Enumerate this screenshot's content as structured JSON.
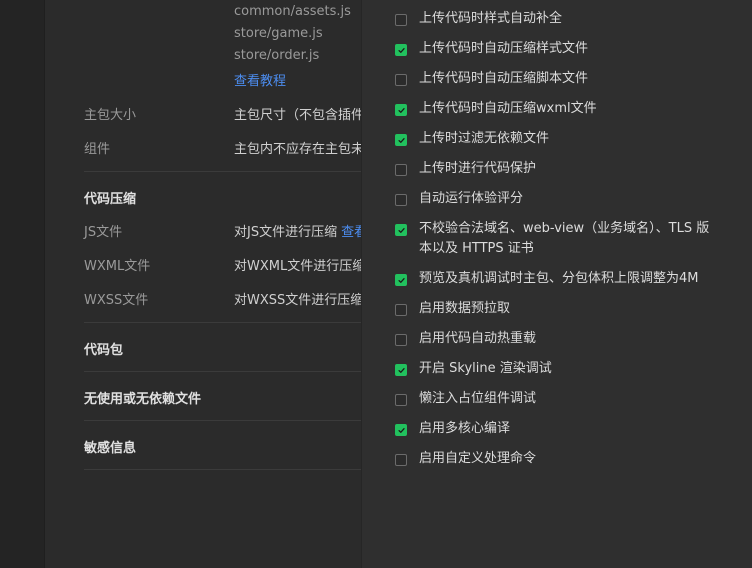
{
  "left": {
    "file_list": [
      "common/assets.js",
      "store/game.js",
      "store/order.js"
    ],
    "doc_link": "查看教程",
    "rows_top": [
      {
        "label": "主包大小",
        "value": "主包尺寸（不包含插件"
      },
      {
        "label": "组件",
        "value": "主包内不应存在主包未"
      }
    ],
    "compress": {
      "title": "代码压缩",
      "rows": [
        {
          "label": "JS文件",
          "value": "对JS文件进行压缩",
          "link": "查看"
        },
        {
          "label": "WXML文件",
          "value": "对WXML文件进行压缩"
        },
        {
          "label": "WXSS文件",
          "value": "对WXSS文件进行压缩"
        }
      ]
    },
    "sections": [
      "代码包",
      "无使用或无依赖文件",
      "敏感信息"
    ]
  },
  "options": [
    {
      "label": "上传代码时样式自动补全",
      "checked": false
    },
    {
      "label": "上传代码时自动压缩样式文件",
      "checked": true
    },
    {
      "label": "上传代码时自动压缩脚本文件",
      "checked": false
    },
    {
      "label": "上传代码时自动压缩wxml文件",
      "checked": true
    },
    {
      "label": "上传时过滤无依赖文件",
      "checked": true
    },
    {
      "label": "上传时进行代码保护",
      "checked": false
    },
    {
      "label": "自动运行体验评分",
      "checked": false
    },
    {
      "label": "不校验合法域名、web-view（业务域名）、TLS 版本以及 HTTPS 证书",
      "checked": true
    },
    {
      "label": "预览及真机调试时主包、分包体积上限调整为4M",
      "checked": true
    },
    {
      "label": "启用数据预拉取",
      "checked": false
    },
    {
      "label": "启用代码自动热重载",
      "checked": false
    },
    {
      "label": "开启 Skyline 渲染调试",
      "checked": true
    },
    {
      "label": "懒注入占位组件调试",
      "checked": false
    },
    {
      "label": "启用多核心编译",
      "checked": true
    },
    {
      "label": "启用自定义处理命令",
      "checked": false
    }
  ],
  "colors": {
    "accent_check": "#22c15e",
    "link": "#4c8df0"
  }
}
